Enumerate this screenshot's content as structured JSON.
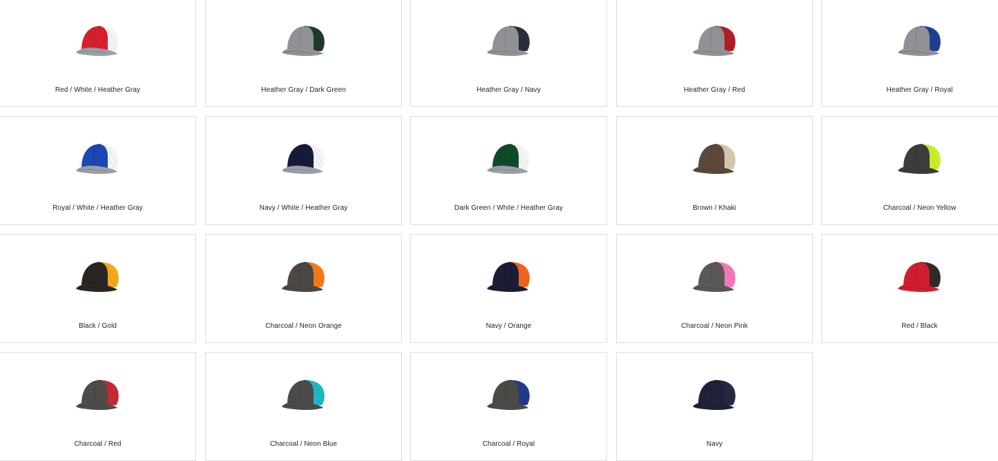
{
  "swatches": [
    {
      "label": "Red / White / Heather Gray",
      "front": "#d61f2e",
      "mesh": "#f4f4f4",
      "bill": "#9a9ea6"
    },
    {
      "label": "Heather Gray / Dark Green",
      "front": "#8f9194",
      "mesh": "#1f3a2b",
      "bill": "#8f9194"
    },
    {
      "label": "Heather Gray / Navy",
      "front": "#8f9194",
      "mesh": "#2a2d3a",
      "bill": "#8f9194"
    },
    {
      "label": "Heather Gray / Red",
      "front": "#8f9194",
      "mesh": "#b01e26",
      "bill": "#8f9194"
    },
    {
      "label": "Heather Gray / Royal",
      "front": "#8f9194",
      "mesh": "#1f3f94",
      "bill": "#8f9194"
    },
    {
      "label": "Royal / White / Heather Gray",
      "front": "#1b46b4",
      "mesh": "#f4f4f4",
      "bill": "#9a9ea6"
    },
    {
      "label": "Navy / White / Heather Gray",
      "front": "#151b38",
      "mesh": "#f4f4f4",
      "bill": "#9a9ea6"
    },
    {
      "label": "Dark Green / White / Heather Gray",
      "front": "#0e4a2a",
      "mesh": "#f4f4f4",
      "bill": "#9a9ea6"
    },
    {
      "label": "Brown / Khaki",
      "front": "#5b4a3c",
      "mesh": "#d3c9ae",
      "bill": "#5b4a3c"
    },
    {
      "label": "Charcoal / Neon Yellow",
      "front": "#3c3c3c",
      "mesh": "#c8f02a",
      "bill": "#3c3c3c"
    },
    {
      "label": "Black / Gold",
      "front": "#2a2522",
      "mesh": "#f1a81c",
      "bill": "#2a2522"
    },
    {
      "label": "Charcoal / Neon Orange",
      "front": "#4a4744",
      "mesh": "#f47a1a",
      "bill": "#4a4744"
    },
    {
      "label": "Navy / Orange",
      "front": "#1a1d33",
      "mesh": "#f0641e",
      "bill": "#1a1d33"
    },
    {
      "label": "Charcoal / Neon Pink",
      "front": "#5a5856",
      "mesh": "#ef7bb6",
      "bill": "#5a5856"
    },
    {
      "label": "Red / Black",
      "front": "#cf1e30",
      "mesh": "#2e2b2b",
      "bill": "#cf1e30"
    },
    {
      "label": "Charcoal / Red",
      "front": "#4e4b49",
      "mesh": "#c52a36",
      "bill": "#4e4b49"
    },
    {
      "label": "Charcoal / Neon Blue",
      "front": "#4a4b49",
      "mesh": "#20b7c2",
      "bill": "#4a4b49"
    },
    {
      "label": "Charcoal / Royal",
      "front": "#4a4a47",
      "mesh": "#223a8c",
      "bill": "#4a4a47"
    },
    {
      "label": "Navy",
      "front": "#1f2236",
      "mesh": "#262a40",
      "bill": "#1f2236"
    }
  ]
}
